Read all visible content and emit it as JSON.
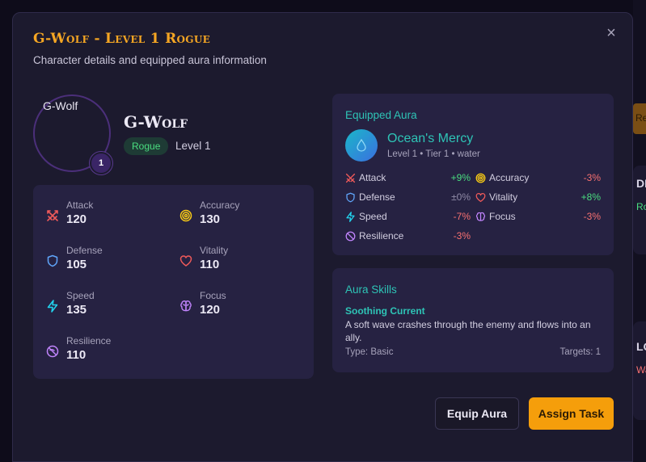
{
  "background": {
    "button_label": "Recruit",
    "card1_title": "DEC",
    "card1_sub": "Rogue",
    "card2_title": "LO",
    "card2_sub": "Warrior"
  },
  "modal": {
    "title": "G-Wolf - Level 1 Rogue",
    "subtitle": "Character details and equipped aura information",
    "close_glyph": "×"
  },
  "character": {
    "avatar_alt": "G-Wolf",
    "level_badge": "1",
    "name": "G-Wolf",
    "class": "Rogue",
    "level_text": "Level 1",
    "stats": [
      {
        "label": "Attack",
        "value": "120",
        "icon": "swords-icon",
        "color": "#f05a5a"
      },
      {
        "label": "Accuracy",
        "value": "130",
        "icon": "target-icon",
        "color": "#facc15"
      },
      {
        "label": "Defense",
        "value": "105",
        "icon": "shield-icon",
        "color": "#60a5fa"
      },
      {
        "label": "Vitality",
        "value": "110",
        "icon": "heart-icon",
        "color": "#f05a5a"
      },
      {
        "label": "Speed",
        "value": "135",
        "icon": "zap-icon",
        "color": "#22d3ee"
      },
      {
        "label": "Focus",
        "value": "120",
        "icon": "brain-icon",
        "color": "#c084fc"
      },
      {
        "label": "Resilience",
        "value": "110",
        "icon": "resilience-icon",
        "color": "#c084fc"
      }
    ]
  },
  "aura": {
    "heading": "Equipped Aura",
    "name": "Ocean's Mercy",
    "meta": "Level 1 • Tier 1 • water",
    "icon": "droplet-icon",
    "modifiers": [
      {
        "label": "Attack",
        "value": "+9%",
        "tone": "positive",
        "icon": "swords-icon"
      },
      {
        "label": "Accuracy",
        "value": "-3%",
        "tone": "negative",
        "icon": "target-icon"
      },
      {
        "label": "Defense",
        "value": "±0%",
        "tone": "neutral",
        "icon": "shield-icon"
      },
      {
        "label": "Vitality",
        "value": "+8%",
        "tone": "positive",
        "icon": "heart-icon"
      },
      {
        "label": "Speed",
        "value": "-7%",
        "tone": "negative",
        "icon": "zap-icon"
      },
      {
        "label": "Focus",
        "value": "-3%",
        "tone": "negative",
        "icon": "brain-icon"
      },
      {
        "label": "Resilience",
        "value": "-3%",
        "tone": "negative",
        "icon": "resilience-icon"
      }
    ]
  },
  "skills": {
    "heading": "Aura Skills",
    "items": [
      {
        "name": "Soothing Current",
        "description": "A soft wave crashes through the enemy and flows into an ally.",
        "type": "Type: Basic",
        "targets": "Targets: 1"
      }
    ]
  },
  "actions": {
    "equip_label": "Equip Aura",
    "assign_label": "Assign Task"
  },
  "colors": {
    "accent": "#f5a623",
    "aura_accent": "#2ec4b6",
    "positive": "#4ade80",
    "negative": "#f87171",
    "neutral": "#8f8aa6",
    "panel": "#262242",
    "modal": "#1c1a2e"
  }
}
